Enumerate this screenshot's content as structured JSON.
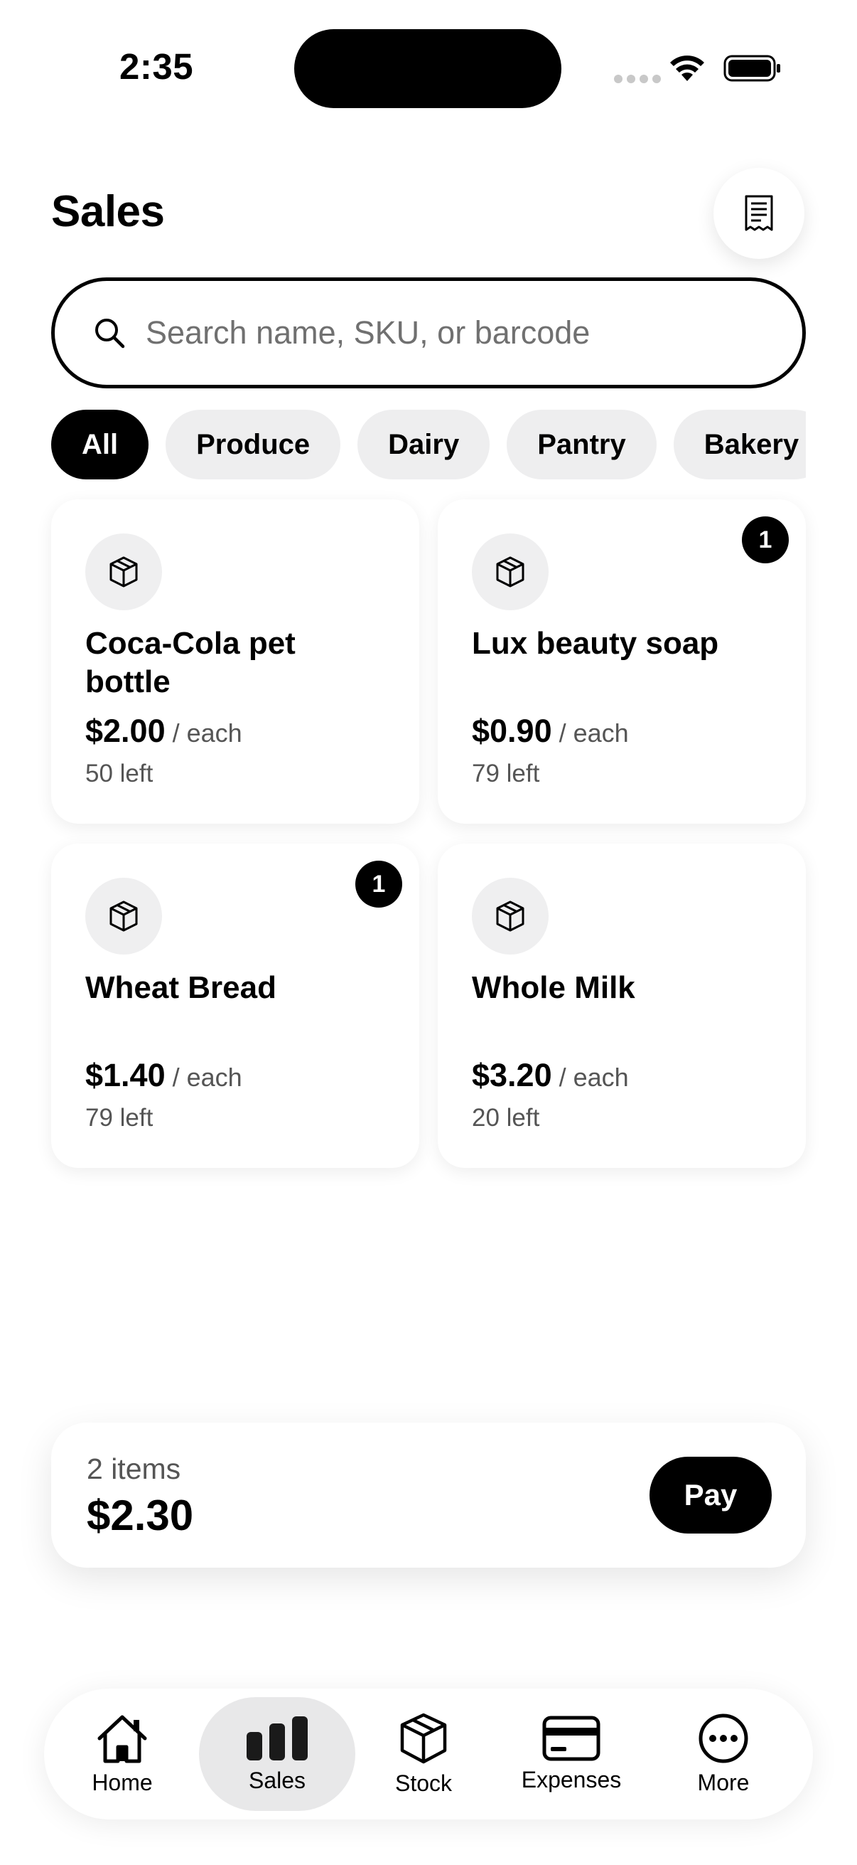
{
  "status_bar": {
    "time": "2:35"
  },
  "header": {
    "title": "Sales",
    "receipt_icon": "receipt-icon"
  },
  "search": {
    "placeholder": "Search name, SKU, or barcode",
    "value": ""
  },
  "categories": [
    {
      "label": "All",
      "active": true
    },
    {
      "label": "Produce",
      "active": false
    },
    {
      "label": "Dairy",
      "active": false
    },
    {
      "label": "Pantry",
      "active": false
    },
    {
      "label": "Bakery",
      "active": false
    }
  ],
  "products": [
    {
      "name": "Coca-Cola pet bottle",
      "price": "$2.00",
      "unit": "/ each",
      "stock": "50 left",
      "qty": null,
      "icon": "box-icon"
    },
    {
      "name": "Lux beauty soap",
      "price": "$0.90",
      "unit": "/ each",
      "stock": "79 left",
      "qty": "1",
      "icon": "box-icon"
    },
    {
      "name": "Wheat Bread",
      "price": "$1.40",
      "unit": "/ each",
      "stock": "79 left",
      "qty": "1",
      "icon": "box-icon"
    },
    {
      "name": "Whole Milk",
      "price": "$3.20",
      "unit": "/ each",
      "stock": "20 left",
      "qty": null,
      "icon": "box-icon"
    }
  ],
  "cart": {
    "count": "2 items",
    "total": "$2.30",
    "pay_label": "Pay"
  },
  "tabs": [
    {
      "label": "Home",
      "icon": "home-icon",
      "active": false
    },
    {
      "label": "Sales",
      "icon": "bar-chart-icon",
      "active": true
    },
    {
      "label": "Stock",
      "icon": "box-icon",
      "active": false
    },
    {
      "label": "Expenses",
      "icon": "card-icon",
      "active": false
    },
    {
      "label": "More",
      "icon": "more-icon",
      "active": false
    }
  ],
  "colors": {
    "accent": "#000000",
    "chip_bg": "#eeeeef",
    "muted_text": "#555555"
  }
}
